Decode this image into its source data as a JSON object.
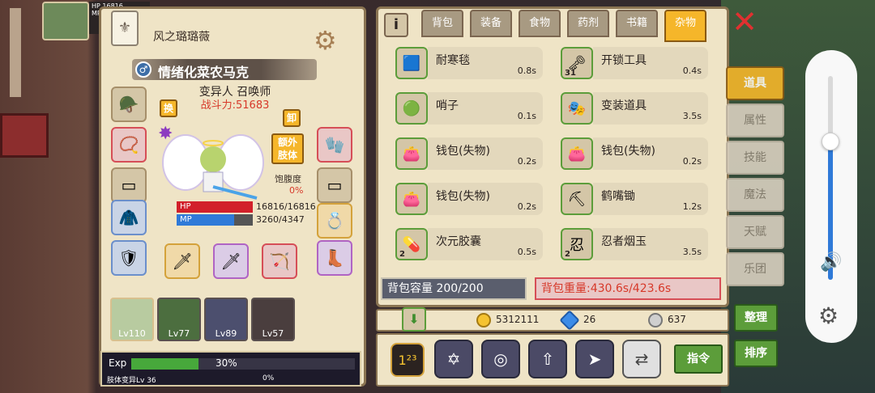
{
  "hud": {
    "hp_short": "HP",
    "hp_val": "16816",
    "mp_short": "MP"
  },
  "character": {
    "guild": "风之璐璐薇",
    "name": "情绪化菜农马克",
    "class": "变异人 召唤师",
    "power": "战斗力:51683",
    "swap_label": "换",
    "unequip_label": "卸",
    "extra_limb": "额外\n肢体",
    "satiety_label": "饱腹度",
    "satiety_value": "0%",
    "hp_label": "HP",
    "hp_value": "16816/16816",
    "hp_ratio": 1.0,
    "mp_label": "MP",
    "mp_value": "3260/4347",
    "mp_ratio": 0.75
  },
  "pets": [
    {
      "level": "Lv110"
    },
    {
      "level": "Lv77"
    },
    {
      "level": "Lv89"
    },
    {
      "level": "Lv57"
    }
  ],
  "exp": {
    "label": "Exp",
    "percent": "30%",
    "ratio": 0.3,
    "sub_label": "肢体变异Lv 36",
    "sub_percent": "0%"
  },
  "bag": {
    "info_icon": "i",
    "tabs": [
      "背包",
      "装备",
      "食物",
      "药剂",
      "书籍",
      "杂物"
    ],
    "active_tab": 5,
    "items": [
      {
        "name": "耐寒毯",
        "weight": "0.8s",
        "icon": "🟦",
        "count": ""
      },
      {
        "name": "开锁工具",
        "weight": "0.4s",
        "icon": "🗝",
        "count": "31"
      },
      {
        "name": "哨子",
        "weight": "0.1s",
        "icon": "🟢",
        "count": ""
      },
      {
        "name": "变装道具",
        "weight": "3.5s",
        "icon": "🎭",
        "count": ""
      },
      {
        "name": "钱包(失物)",
        "weight": "0.2s",
        "icon": "👛",
        "count": ""
      },
      {
        "name": "钱包(失物)",
        "weight": "0.2s",
        "icon": "👛",
        "count": ""
      },
      {
        "name": "钱包(失物)",
        "weight": "0.2s",
        "icon": "👛",
        "count": ""
      },
      {
        "name": "鹤嘴锄",
        "weight": "1.2s",
        "icon": "⛏",
        "count": ""
      },
      {
        "name": "次元胶囊",
        "weight": "0.5s",
        "icon": "💊",
        "count": "2"
      },
      {
        "name": "忍者烟玉",
        "weight": "3.5s",
        "icon": "忍",
        "count": "2"
      }
    ],
    "capacity": "背包容量 200/200",
    "weight": "背包重量:430.6s/423.6s"
  },
  "currency": {
    "gold": "5312111",
    "diamond": "26",
    "coin": "637"
  },
  "actions": {
    "command": "指令"
  },
  "side_tabs": [
    "道具",
    "属性",
    "技能",
    "魔法",
    "天赋",
    "乐团"
  ],
  "side_active": 0,
  "side_buttons": {
    "organize": "整理",
    "sort": "排序"
  },
  "volume": {
    "level": 0.68
  }
}
